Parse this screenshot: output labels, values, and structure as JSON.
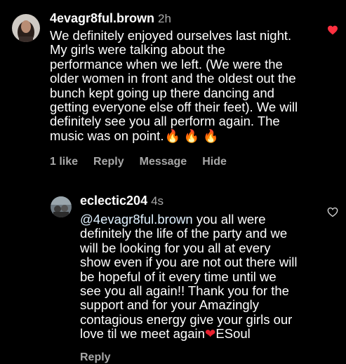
{
  "comment": {
    "username": "4evagr8ful.brown",
    "time": "2h",
    "text_lines": [
      "We definitely enjoyed ourselves last night.",
      "My girls were talking about the",
      "performance when we left. (We were the",
      "older women in front and the oldest out the",
      "bunch kept going up there dancing and",
      "getting everyone else off their feet). We will",
      "definitely see you all perform again. The"
    ],
    "last_line_text": "music was on point.",
    "last_line_emoji": "🔥 🔥 🔥",
    "likes": "1 like",
    "reply": "Reply",
    "message": "Message",
    "hide": "Hide",
    "liked": true,
    "heart_color": "#ff3040"
  },
  "reply_comment": {
    "username": "eclectic204",
    "time": "4s",
    "mention": "@4evagr8ful.brown",
    "first_line_rest": " you all were",
    "text_lines": [
      "definitely the life of the party and we",
      "will be looking for you all at every",
      "show even if you are not out there will",
      "be hopeful of it every time until we",
      "see you all again!! Thank you for the",
      "support and for your Amazingly",
      "contagious energy give your girls our"
    ],
    "last_line_text": "love til we meet again",
    "last_line_emoji": "❤",
    "signature": "ESoul",
    "reply": "Reply",
    "liked": false
  }
}
